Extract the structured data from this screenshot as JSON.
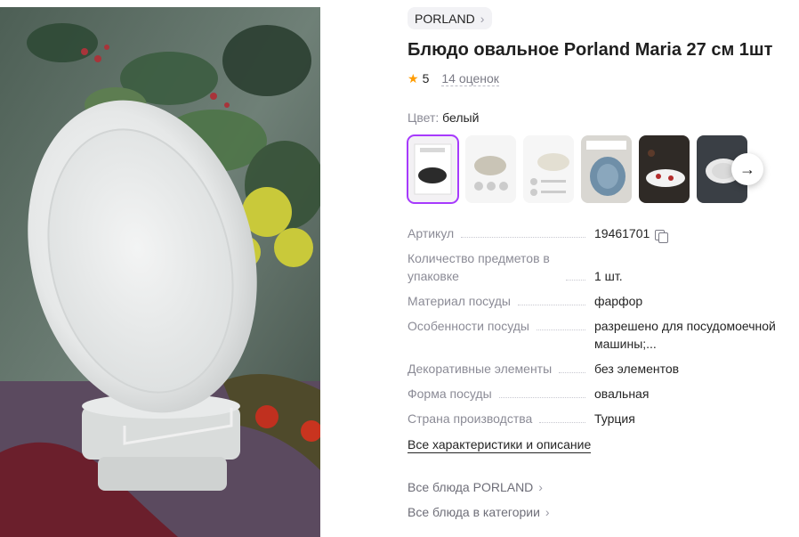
{
  "brand": {
    "name": "PORLAND",
    "chevron_icon": "chevron-right-icon"
  },
  "product": {
    "title": "Блюдо овальное Porland Maria 27 см 1шт"
  },
  "rating": {
    "value": "5",
    "reviews_label": "14 оценок",
    "star_color": "#ff9c00"
  },
  "color": {
    "label": "Цвет:",
    "value": "белый"
  },
  "thumbnails": {
    "count": 6,
    "selected_index": 0,
    "accent": "#a73afd",
    "next_icon": "arrow-right-icon"
  },
  "specs": [
    {
      "key": "Артикул",
      "value": "19461701",
      "copy_icon": "copy-icon"
    },
    {
      "key": "Количество предметов в упаковке",
      "value": "1 шт."
    },
    {
      "key": "Материал посуды",
      "value": "фарфор"
    },
    {
      "key": "Особенности посуды",
      "value": "разрешено для посудомоечной машины;..."
    },
    {
      "key": "Декоративные элементы",
      "value": "без элементов"
    },
    {
      "key": "Форма посуды",
      "value": "овальная"
    },
    {
      "key": "Страна производства",
      "value": "Турция"
    }
  ],
  "links": {
    "all_specs": "Все характеристики и описание",
    "all_brand": "Все блюда PORLAND",
    "all_category": "Все блюда в категории"
  }
}
